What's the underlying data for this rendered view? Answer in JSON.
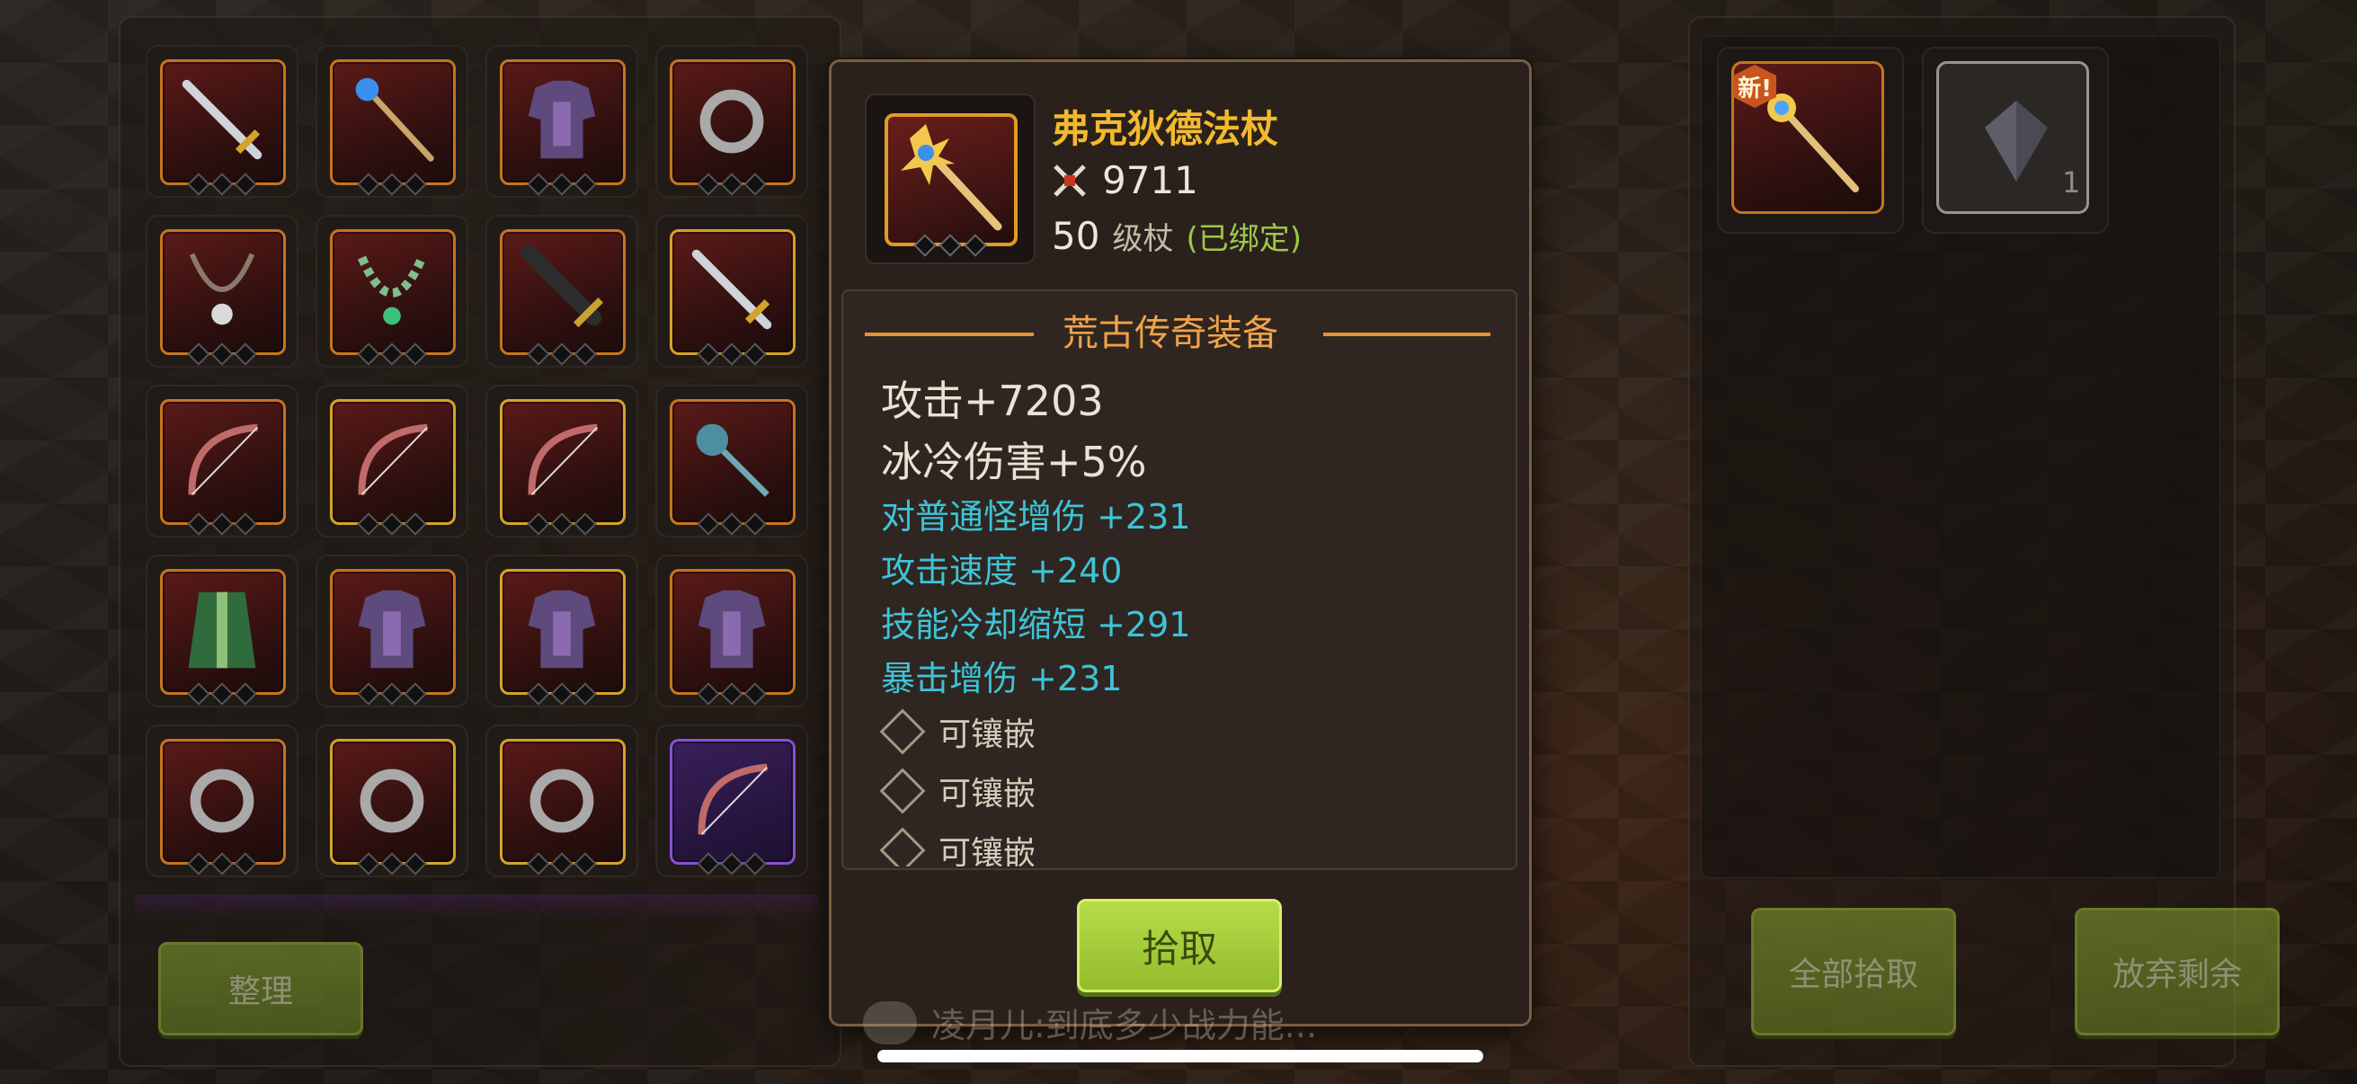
{
  "tooltip": {
    "item_name": "弗克狄德法杖",
    "power_icon": "crossed-swords-icon",
    "power": "9711",
    "level": "50",
    "level_type": "级杖",
    "bound_status": "(已绑定)",
    "section_title": "荒古传奇装备",
    "main_stats": [
      "攻击+7203",
      "冰冷伤害+5%"
    ],
    "sub_stats": [
      "对普通怪增伤 +231",
      "攻击速度 +240",
      "技能冷却缩短 +291",
      "暴击增伤 +231"
    ],
    "sockets": [
      "可镶嵌",
      "可镶嵌",
      "可镶嵌"
    ],
    "pickup_label": "拾取"
  },
  "left_panel": {
    "sort_label": "整理",
    "slots": [
      {
        "icon": "sword-icon",
        "frame": "orange"
      },
      {
        "icon": "staff-icon",
        "frame": "orange"
      },
      {
        "icon": "armor-icon",
        "frame": "orange"
      },
      {
        "icon": "ring-icon",
        "frame": "orange"
      },
      {
        "icon": "necklace-icon",
        "frame": "orange"
      },
      {
        "icon": "bead-necklace-icon",
        "frame": "orange"
      },
      {
        "icon": "greatsword-icon",
        "frame": "orange"
      },
      {
        "icon": "sword-icon",
        "frame": "gold"
      },
      {
        "icon": "bow-icon",
        "frame": "orange"
      },
      {
        "icon": "bow-icon",
        "frame": "gold"
      },
      {
        "icon": "bow-icon",
        "frame": "gold"
      },
      {
        "icon": "mace-icon",
        "frame": "orange"
      },
      {
        "icon": "robe-icon",
        "frame": "orange"
      },
      {
        "icon": "armor-icon",
        "frame": "orange"
      },
      {
        "icon": "armor-icon",
        "frame": "gold"
      },
      {
        "icon": "armor-icon",
        "frame": "orange"
      },
      {
        "icon": "ring-icon",
        "frame": "orange"
      },
      {
        "icon": "ring-icon",
        "frame": "gold"
      },
      {
        "icon": "ring-icon",
        "frame": "gold"
      },
      {
        "icon": "bow-icon",
        "frame": "purple"
      }
    ]
  },
  "right_panel": {
    "new_badge": "新!",
    "loot_items": [
      {
        "icon": "staff-icon",
        "frame": "orange"
      },
      {
        "icon": "crystal-icon",
        "frame": "gray",
        "count": "1"
      }
    ],
    "pick_all_label": "全部拾取",
    "discard_rest_label": "放弃剩余"
  },
  "chat": {
    "line": "凌月儿:到底多少战力能..."
  },
  "colors": {
    "legend_title": "#f3b92e",
    "sub_stat": "#3fc3d6",
    "bound": "#9fc84a",
    "orange_frame": "#c7741f",
    "gold_frame": "#d4a329",
    "purple_frame": "#8a4fd8"
  }
}
